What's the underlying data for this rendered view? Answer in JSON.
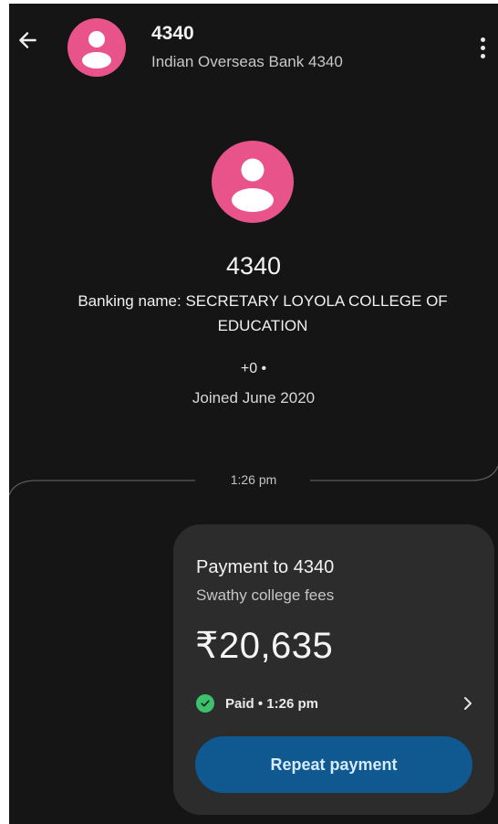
{
  "colors": {
    "background": "#151515",
    "avatar": "#e8548a",
    "card": "#2c2c2c",
    "button": "#0f5890",
    "button_text": "#d6ebff",
    "paid_check": "#3ec16d"
  },
  "header": {
    "title": "4340",
    "subtitle": "Indian Overseas Bank 4340",
    "back_icon": "arrow-left-icon",
    "more_icon": "more-vertical-icon"
  },
  "profile": {
    "name": "4340",
    "banking_name": "Banking name: SECRETARY LOYOLA COLLEGE OF EDUCATION",
    "phone": "+0 •",
    "joined": "Joined June 2020"
  },
  "conversation": {
    "time_divider": "1:26 pm"
  },
  "payment": {
    "title": "Payment to 4340",
    "note": "Swathy college fees",
    "amount": "₹20,635",
    "status": "Paid • 1:26 pm",
    "repeat_label": "Repeat payment"
  }
}
